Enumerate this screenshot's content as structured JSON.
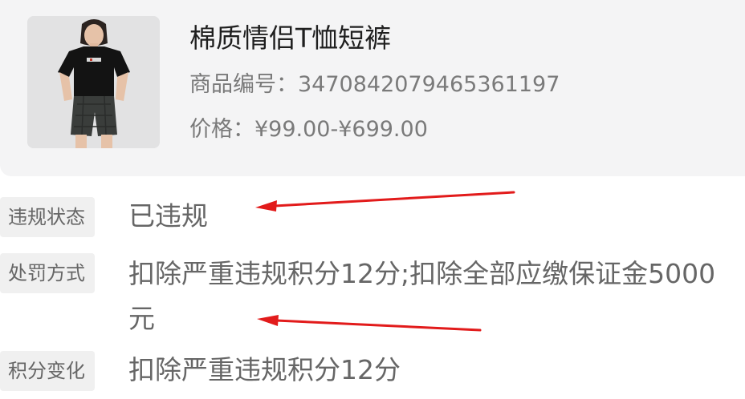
{
  "product": {
    "title": "棉质情侣T恤短裤",
    "sku_line": "商品编号：3470842079465361197",
    "price_line": "价格：¥99.00-¥699.00"
  },
  "violation": {
    "status_label": "违规状态",
    "status_value": "已违规",
    "penalty_label": "处罚方式",
    "penalty_value": "扣除严重违规积分12分;扣除全部应缴保证金5000元",
    "points_label": "积分变化",
    "points_value": "扣除严重违规积分12分"
  },
  "colors": {
    "annotation_arrow": "#e21b1b",
    "card_background": "#f4f4f5"
  },
  "icons": {
    "product_image": "product-photo"
  }
}
